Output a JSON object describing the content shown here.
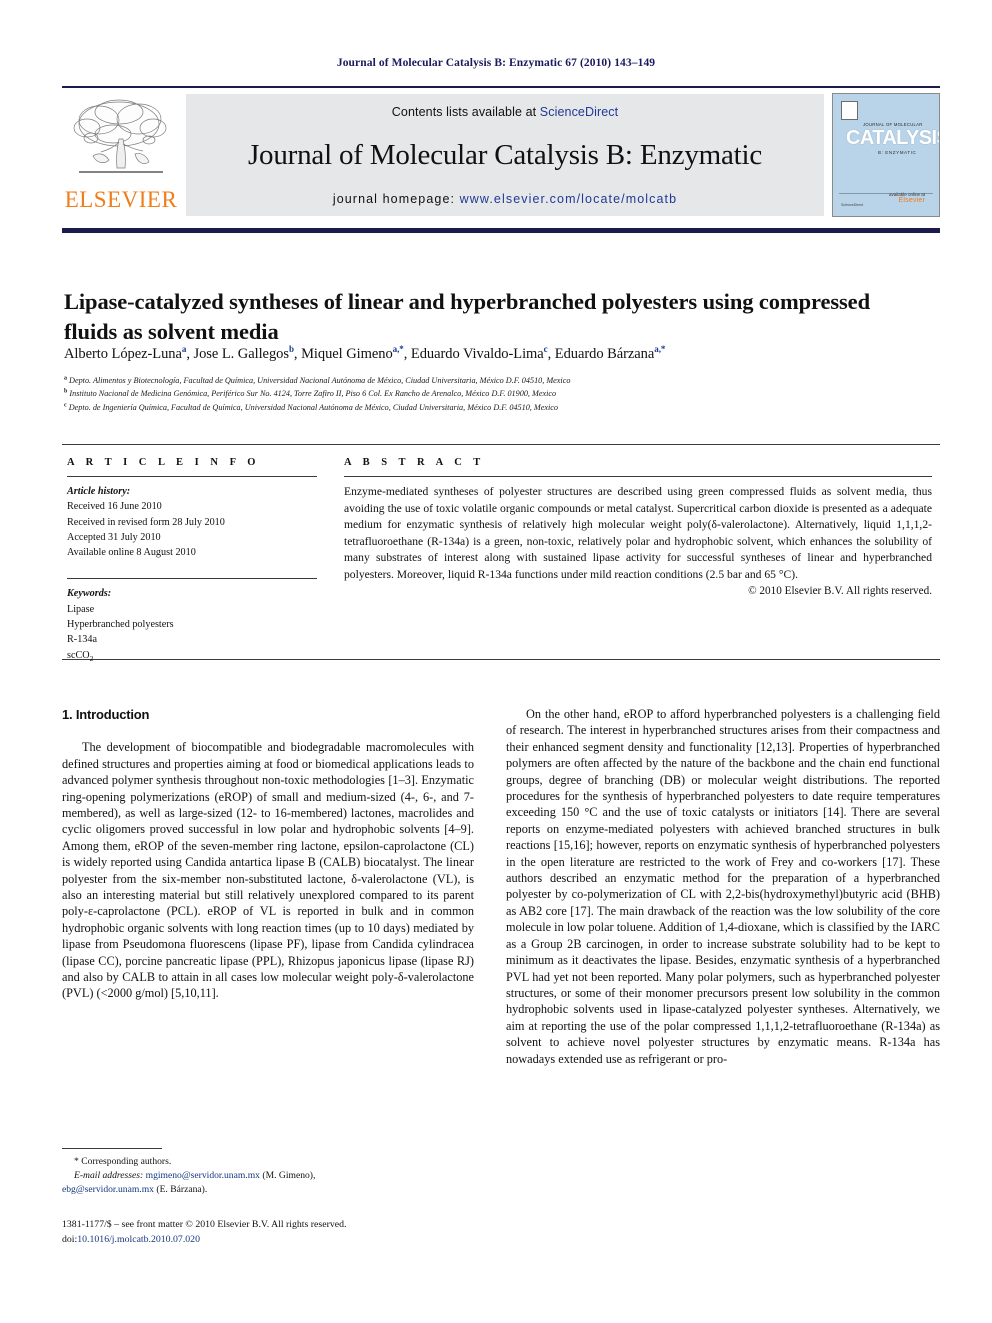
{
  "running_head": "Journal of Molecular Catalysis B: Enzymatic 67 (2010) 143–149",
  "masthead": {
    "publisher": "ELSEVIER",
    "contents_prefix": "Contents lists available at ",
    "contents_link": "ScienceDirect",
    "journal_title": "Journal of Molecular Catalysis B: Enzymatic",
    "homepage_prefix": "journal homepage: ",
    "homepage_url": "www.elsevier.com/locate/molcatb",
    "cover": {
      "line_top": "JOURNAL OF MOLECULAR",
      "main": "CATALYSIS",
      "line_sub": "B: ENZYMATIC",
      "side": "JOURNAL OF",
      "publisher_small": "Elsevier",
      "available_online": "available online at",
      "bottom_left": "ScienceDirect"
    },
    "accent_color": "#1b1b4d",
    "link_color": "#1f3a93",
    "elsevier_orange": "#ef7d1a"
  },
  "article": {
    "title": "Lipase-catalyzed syntheses of linear and hyperbranched polyesters using compressed fluids as solvent media",
    "authors": [
      {
        "name": "Alberto López-Luna",
        "marks": "a"
      },
      {
        "name": "Jose L. Gallegos",
        "marks": "b"
      },
      {
        "name": "Miquel Gimeno",
        "marks": "a,*"
      },
      {
        "name": "Eduardo Vivaldo-Lima",
        "marks": "c"
      },
      {
        "name": "Eduardo Bárzana",
        "marks": "a,*"
      }
    ],
    "affiliations": [
      {
        "mark": "a",
        "text": "Depto. Alimentos y Biotecnología, Facultad de Química, Universidad Nacional Autónoma de México, Ciudad Universitaria, México D.F. 04510, Mexico"
      },
      {
        "mark": "b",
        "text": "Instituto Nacional de Medicina Genómica, Periférico Sur No. 4124, Torre Zafiro II, Piso 6 Col. Ex Rancho de Arenalco, México D.F. 01900, Mexico"
      },
      {
        "mark": "c",
        "text": "Depto. de Ingeniería Química, Facultad de Química, Universidad Nacional Autónoma de México, Ciudad Universitaria, México D.F. 04510, Mexico"
      }
    ]
  },
  "article_info": {
    "heading": "A R T I C L E   I N F O",
    "history_label": "Article history:",
    "history": [
      "Received 16 June 2010",
      "Received in revised form 28 July 2010",
      "Accepted 31 July 2010",
      "Available online 8 August 2010"
    ],
    "keywords_label": "Keywords:",
    "keywords": [
      "Lipase",
      "Hyperbranched polyesters",
      "R-134a",
      "scCO2"
    ]
  },
  "abstract": {
    "heading": "A B S T R A C T",
    "text": "Enzyme-mediated syntheses of polyester structures are described using green compressed fluids as solvent media, thus avoiding the use of toxic volatile organic compounds or metal catalyst. Supercritical carbon dioxide is presented as a adequate medium for enzymatic synthesis of relatively high molecular weight poly(δ-valerolactone). Alternatively, liquid 1,1,1,2-tetrafluoroethane (R-134a) is a green, non-toxic, relatively polar and hydrophobic solvent, which enhances the solubility of many substrates of interest along with sustained lipase activity for successful syntheses of linear and hyperbranched polyesters. Moreover, liquid R-134a functions under mild reaction conditions (2.5 bar and 65 °C).",
    "copyright": "© 2010 Elsevier B.V. All rights reserved."
  },
  "body": {
    "section_heading": "1. Introduction",
    "left_paragraph_1": "The development of biocompatible and biodegradable macromolecules with defined structures and properties aiming at food or biomedical applications leads to advanced polymer synthesis throughout non-toxic methodologies [1–3]. Enzymatic ring-opening polymerizations (eROP) of small and medium-sized (4-, 6-, and 7-membered), as well as large-sized (12- to 16-membered) lactones, macrolides and cyclic oligomers proved successful in low polar and hydrophobic solvents [4–9]. Among them, eROP of the seven-member ring lactone, epsilon-caprolactone (CL) is widely reported using Candida antartica lipase B (CALB) biocatalyst. The linear polyester from the six-member non-substituted lactone, δ-valerolactone (VL), is also an interesting material but still relatively unexplored compared to its parent poly-ε-caprolactone (PCL). eROP of VL is reported in bulk and in common hydrophobic organic solvents with long reaction times (up to 10 days) mediated by lipase from Pseudomona fluorescens (lipase PF), lipase from Candida cylindracea (lipase CC), porcine pancreatic lipase (PPL), Rhizopus japonicus lipase (lipase RJ) and also by CALB to attain in all cases low molecular weight poly-δ-valerolactone (PVL) (<2000 g/mol) [5,10,11].",
    "right_paragraph_1": "On the other hand, eROP to afford hyperbranched polyesters is a challenging field of research. The interest in hyperbranched structures arises from their compactness and their enhanced segment density and functionality [12,13]. Properties of hyperbranched polymers are often affected by the nature of the backbone and the chain end functional groups, degree of branching (DB) or molecular weight distributions. The reported procedures for the synthesis of hyperbranched polyesters to date require temperatures exceeding 150 °C and the use of toxic catalysts or initiators [14]. There are several reports on enzyme-mediated polyesters with achieved branched structures in bulk reactions [15,16]; however, reports on enzymatic synthesis of hyperbranched polyesters in the open literature are restricted to the work of Frey and co-workers [17]. These authors described an enzymatic method for the preparation of a hyperbranched polyester by co-polymerization of CL with 2,2-bis(hydroxymethyl)butyric acid (BHB) as AB2 core [17]. The main drawback of the reaction was the low solubility of the core molecule in low polar toluene. Addition of 1,4-dioxane, which is classified by the IARC as a Group 2B carcinogen, in order to increase substrate solubility had to be kept to minimum as it deactivates the lipase. Besides, enzymatic synthesis of a hyperbranched PVL had yet not been reported. Many polar polymers, such as hyperbranched polyester structures, or some of their monomer precursors present low solubility in the common hydrophobic solvents used in lipase-catalyzed polyester syntheses. Alternatively, we aim at reporting the use of the polar compressed 1,1,1,2-tetrafluoroethane (R-134a) as solvent to achieve novel polyester structures by enzymatic means. R-134a has nowadays extended use as refrigerant or pro-"
  },
  "footnotes": {
    "corresponding": "* Corresponding authors.",
    "email_label": "E-mail addresses:",
    "email1": "mgimeno@servidor.unam.mx",
    "email1_who": "(M. Gimeno),",
    "email2": "ebg@servidor.unam.mx",
    "email2_who": "(E. Bárzana).",
    "issn_line": "1381-1177/$ – see front matter © 2010 Elsevier B.V. All rights reserved.",
    "doi_label": "doi:",
    "doi_value": "10.1016/j.molcatb.2010.07.020"
  }
}
